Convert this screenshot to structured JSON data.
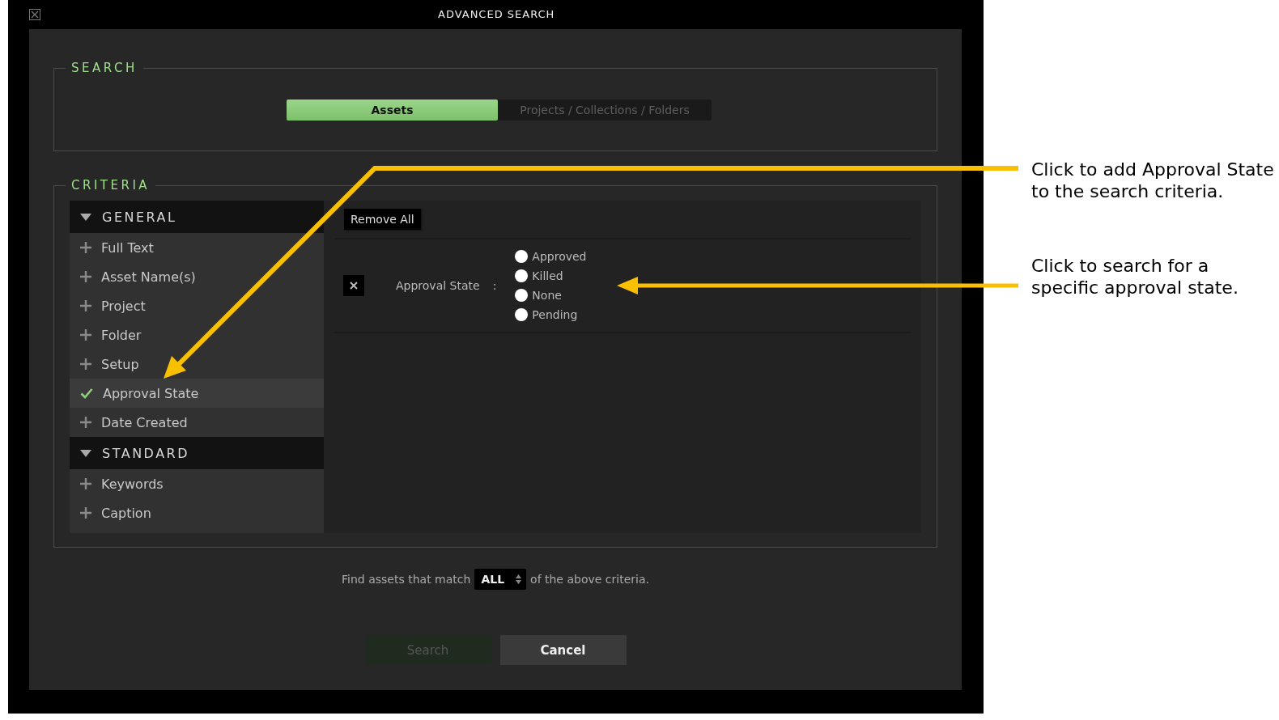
{
  "window": {
    "title": "ADVANCED SEARCH"
  },
  "search_section": {
    "heading": "SEARCH",
    "tabs": [
      {
        "label": "Assets",
        "selected": true
      },
      {
        "label": "Projects / Collections / Folders",
        "selected": false
      }
    ]
  },
  "criteria_section": {
    "heading": "CRITERIA",
    "groups": [
      {
        "title": "GENERAL",
        "expanded": true,
        "items": [
          {
            "label": "Full Text",
            "checked": false
          },
          {
            "label": "Asset Name(s)",
            "checked": false
          },
          {
            "label": "Project",
            "checked": false
          },
          {
            "label": "Folder",
            "checked": false
          },
          {
            "label": "Setup",
            "checked": false
          },
          {
            "label": "Approval State",
            "checked": true
          },
          {
            "label": "Date Created",
            "checked": false
          }
        ]
      },
      {
        "title": "STANDARD",
        "expanded": true,
        "items": [
          {
            "label": "Keywords",
            "checked": false
          },
          {
            "label": "Caption",
            "checked": false
          }
        ]
      }
    ],
    "remove_all_button": "Remove All",
    "criteria_rows": [
      {
        "label": "Approval State",
        "separator": ":",
        "options": [
          {
            "label": "Approved",
            "selected": false
          },
          {
            "label": "Killed",
            "selected": false
          },
          {
            "label": "None",
            "selected": false
          },
          {
            "label": "Pending",
            "selected": false
          }
        ]
      }
    ]
  },
  "match": {
    "prefix": "Find assets that match",
    "value": "ALL",
    "suffix": "of the above criteria."
  },
  "buttons": [
    {
      "label": "Search",
      "disabled": true
    },
    {
      "label": "Cancel",
      "disabled": false
    }
  ],
  "annotations": [
    {
      "text": "Click to add Approval State to the search criteria."
    },
    {
      "text": "Click to search for a specific approval state."
    }
  ]
}
